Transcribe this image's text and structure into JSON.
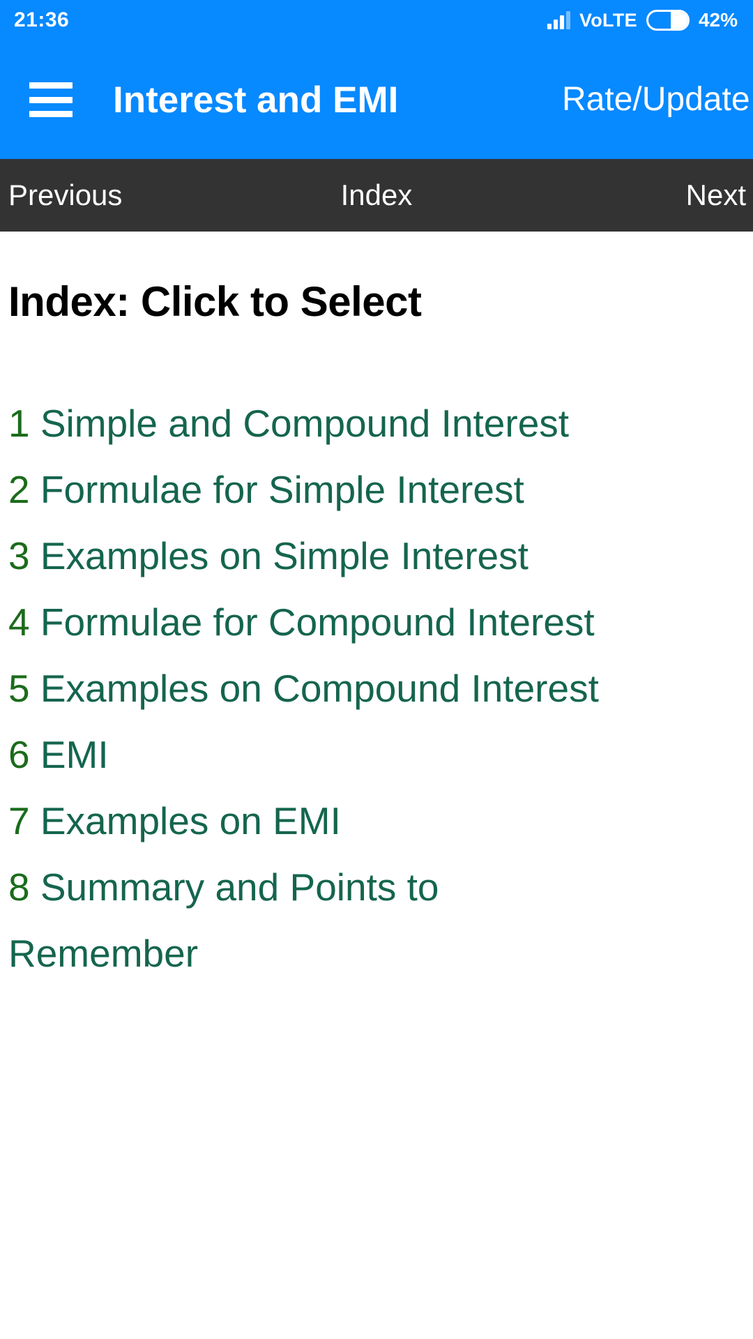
{
  "status_bar": {
    "time": "21:36",
    "network_label": "VoLTE",
    "battery_percent": "42%",
    "battery_level": 42,
    "signal_bars": 4,
    "icons": {
      "signal": "signal-bars-icon",
      "battery": "battery-icon"
    },
    "background_color": "#0789ff"
  },
  "app_bar": {
    "menu_icon": "hamburger-menu-icon",
    "title": "Interest and EMI",
    "action_label": "Rate/Update",
    "background_color": "#0789ff"
  },
  "nav_bar": {
    "previous_label": "Previous",
    "index_label": "Index",
    "next_label": "Next",
    "background_color": "#333333"
  },
  "main": {
    "heading": "Index: Click to Select",
    "heading_color": "#000000",
    "item_text_color": "#15654e",
    "item_number_color": "#1b6b1b",
    "items": [
      {
        "number": "1",
        "label": "Simple and Compound Interest"
      },
      {
        "number": "2",
        "label": "Formulae for Simple Interest"
      },
      {
        "number": "3",
        "label": "Examples on Simple Interest"
      },
      {
        "number": "4",
        "label": "Formulae for Compound Interest"
      },
      {
        "number": "5",
        "label": "Examples on Compound Interest"
      },
      {
        "number": "6",
        "label": "EMI"
      },
      {
        "number": "7",
        "label": "Examples on EMI"
      },
      {
        "number": "8",
        "label": "Summary and Points to Remember"
      }
    ]
  }
}
